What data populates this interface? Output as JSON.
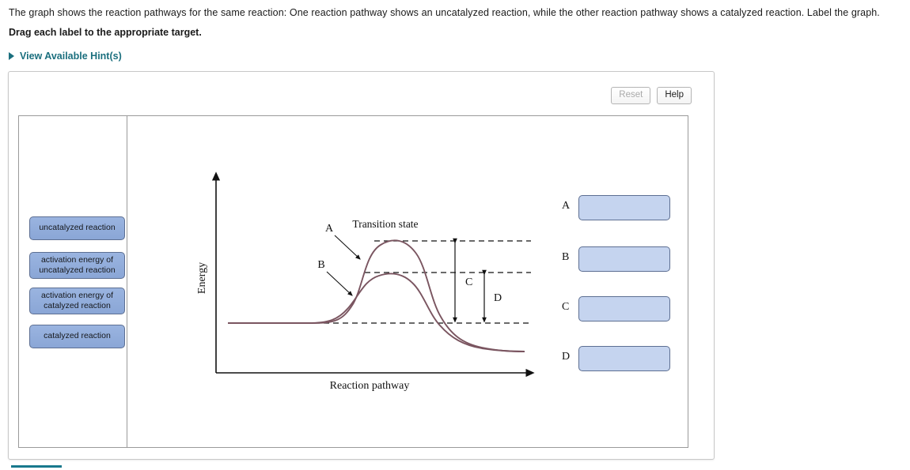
{
  "prompt": {
    "question": "The graph shows the reaction pathways for the same reaction: One reaction pathway shows an uncatalyzed reaction, while the other reaction pathway shows a catalyzed reaction. Label the graph.",
    "instruction": "Drag each label to the appropriate target.",
    "hints_label": "View Available Hint(s)",
    "hints_arrow_icon": "triangle-right-icon"
  },
  "toolbar": {
    "reset_label": "Reset",
    "help_label": "Help"
  },
  "label_bank": {
    "items": [
      {
        "id": "uncatalyzed-reaction",
        "text": "uncatalyzed reaction",
        "lines": 1
      },
      {
        "id": "activation-energy-uncatalyzed",
        "text": "activation energy of uncatalyzed reaction",
        "lines": 2
      },
      {
        "id": "activation-energy-catalyzed",
        "text": "activation energy of catalyzed reaction",
        "lines": 2
      },
      {
        "id": "catalyzed-reaction",
        "text": "catalyzed reaction",
        "lines": 1
      }
    ]
  },
  "graph": {
    "y_axis_label": "Energy",
    "x_axis_label": "Reaction pathway",
    "transition_state_label": "Transition state",
    "callouts": [
      {
        "id": "A",
        "letter": "A"
      },
      {
        "id": "B",
        "letter": "B"
      }
    ],
    "measures": [
      {
        "id": "C",
        "letter": "C"
      },
      {
        "id": "D",
        "letter": "D"
      }
    ],
    "curve_color": "#7a5560",
    "dashed_color": "#111111"
  },
  "drop_targets": [
    {
      "letter": "A",
      "value": ""
    },
    {
      "letter": "B",
      "value": ""
    },
    {
      "letter": "C",
      "value": ""
    },
    {
      "letter": "D",
      "value": ""
    }
  ],
  "chart_data": {
    "type": "line",
    "title": "",
    "xlabel": "Reaction pathway",
    "ylabel": "Energy",
    "annotations": [
      "Transition state",
      "A",
      "B",
      "C",
      "D"
    ],
    "series": [
      {
        "name": "uncatalyzed reaction",
        "description": "higher activation energy barrier curve (upper peak)",
        "reactant_level": 0,
        "peak_level": 100,
        "product_level": -55
      },
      {
        "name": "catalyzed reaction",
        "description": "lower activation energy barrier curve (lower peak)",
        "reactant_level": 0,
        "peak_level": 62,
        "product_level": -55
      }
    ],
    "levels": {
      "uncatalyzed_peak": 100,
      "catalyzed_peak": 62,
      "reactants": 0,
      "products": -55
    },
    "measures": {
      "C": "activation energy of uncatalyzed reaction (reactants to upper peak)",
      "D": "activation energy of catalyzed reaction (reactants to lower peak)"
    },
    "grid": false,
    "legend": "none"
  }
}
